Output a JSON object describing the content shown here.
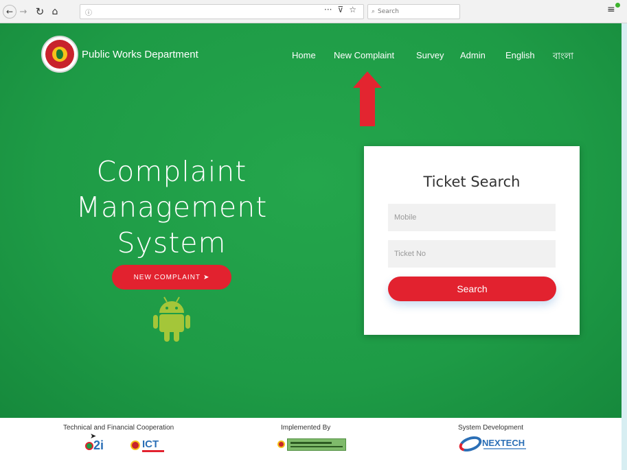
{
  "browser": {
    "search_placeholder": "Search",
    "icons": [
      "back-arrow-icon",
      "forward-arrow-icon",
      "reload-icon",
      "home-icon",
      "info-icon",
      "more-icon",
      "pocket-icon",
      "bookmark-star-icon",
      "search-icon",
      "menu-icon"
    ]
  },
  "header": {
    "brand": "Public Works Department",
    "nav": [
      "Home",
      "New Complaint",
      "Survey",
      "Admin",
      "English",
      "বাংলা"
    ]
  },
  "hero": {
    "title_lines": [
      "Complaint",
      "Management",
      "System"
    ],
    "cta_label": "NEW COMPLAINT"
  },
  "ticket_search": {
    "title": "Ticket Search",
    "mobile_placeholder": "Mobile",
    "ticket_placeholder": "Ticket No",
    "button_label": "Search"
  },
  "footer": {
    "tech_label": "Technical and Financial Cooperation",
    "impl_label": "Implemented By",
    "dev_label": "System Development",
    "ict_logo_text": "ICT",
    "nextech_logo_text": "NEXTECH"
  },
  "colors": {
    "page_green": "#1e9b46",
    "accent_red": "#e2222f",
    "arrow_red": "#e32530",
    "android_green": "#a4c639"
  }
}
